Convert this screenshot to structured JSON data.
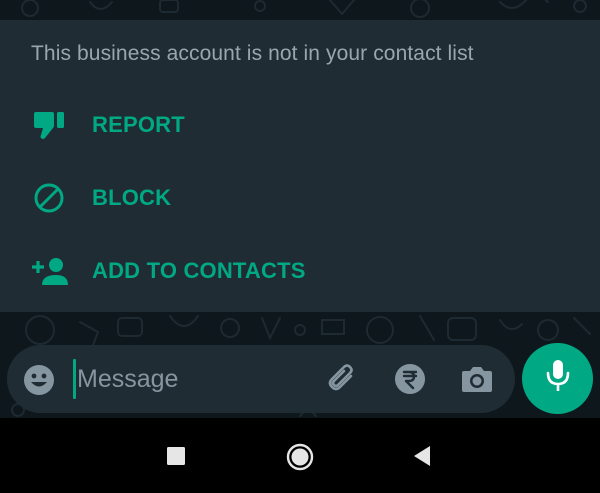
{
  "colors": {
    "accent": "#00a884",
    "panel_bg": "#202c33",
    "muted_text": "#9aa6ad",
    "wallpaper_bg": "#0e171c"
  },
  "contact_panel": {
    "title": "This business account is not in your contact list",
    "actions": [
      {
        "label": "REPORT",
        "icon": "thumb-down-icon"
      },
      {
        "label": "BLOCK",
        "icon": "block-icon"
      },
      {
        "label": "ADD TO CONTACTS",
        "icon": "add-person-icon"
      }
    ]
  },
  "composer": {
    "placeholder": "Message",
    "value": "",
    "icons": [
      "emoji-icon",
      "paperclip-icon",
      "rupee-payment-icon",
      "camera-icon"
    ],
    "send_icon": "microphone-icon"
  },
  "navbar": {
    "buttons": [
      "recents-icon",
      "home-icon",
      "back-icon"
    ]
  }
}
